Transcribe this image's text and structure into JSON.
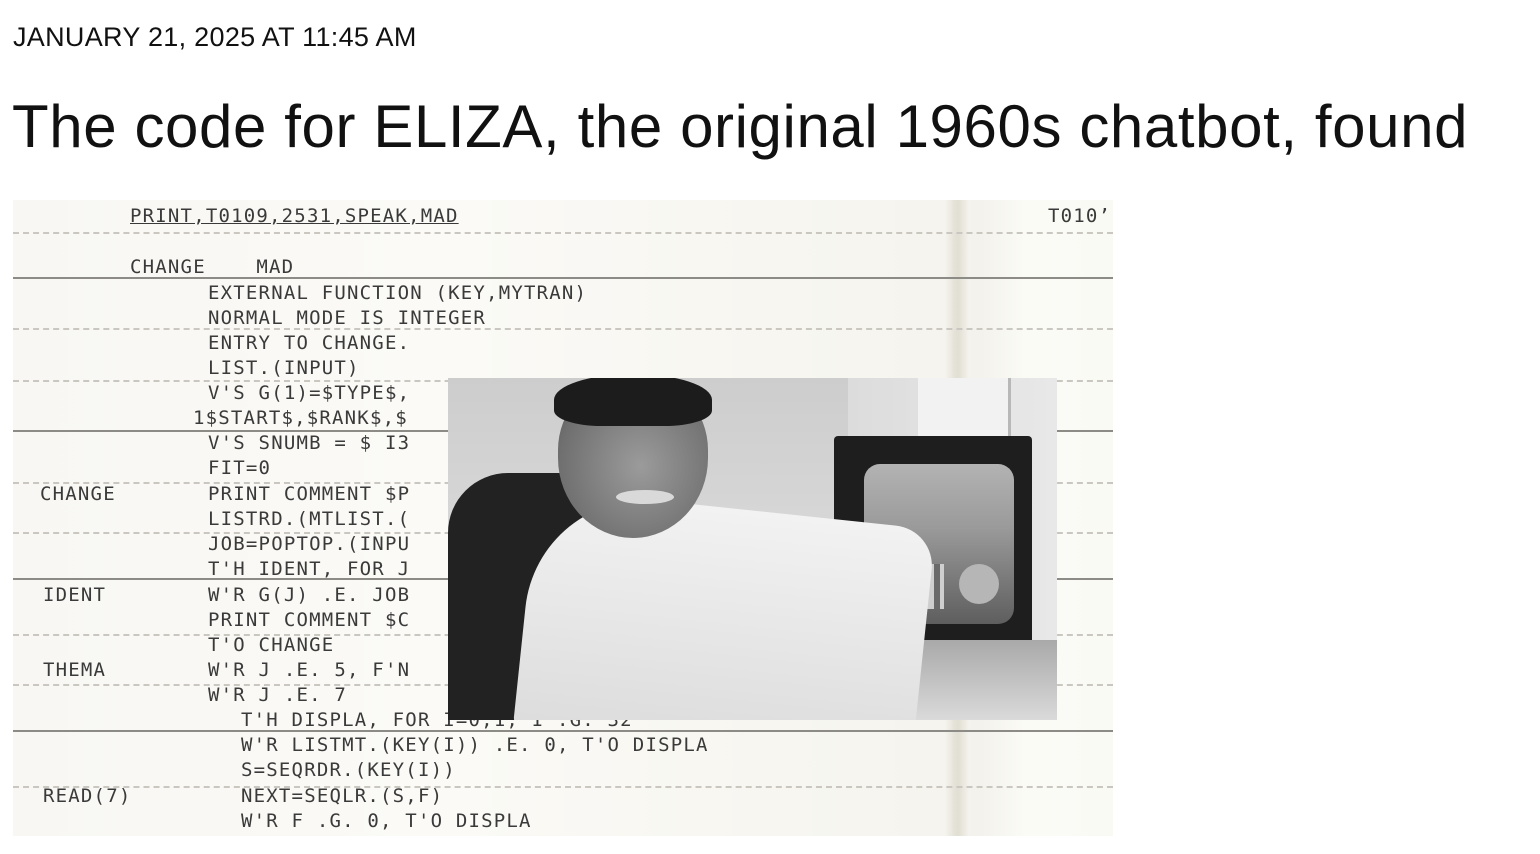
{
  "article": {
    "dateline": "JANUARY 21, 2025 AT 11:45 AM",
    "headline": "The code for ELIZA, the original 1960s chatbot, found"
  },
  "hero_image": {
    "code_lines": {
      "l01": "PRINT,T0109,2531,SPEAK,MAD",
      "l01_right": "T010’",
      "l02": "CHANGE    MAD",
      "l03": "EXTERNAL FUNCTION (KEY,MYTRAN)",
      "l04": "NORMAL MODE IS INTEGER",
      "l05": "ENTRY TO CHANGE.",
      "l06": "LIST.(INPUT)",
      "l07": "V'S G(1)=$TYPE$,",
      "l08": "1$START$,$RANK$,$",
      "l09": "V'S SNUMB = $ I3",
      "l10": "FIT=0",
      "l11": "PRINT COMMENT $P",
      "l12": "LISTRD.(MTLIST.(",
      "l13": "JOB=POPTOP.(INPU",
      "l14": "T'H IDENT, FOR J",
      "l15": "W'R G(J) .E. JOB",
      "l16": "PRINT COMMENT $C",
      "l17": "T'O CHANGE",
      "l18": "W'R J .E. 5, F'N",
      "l19": "W'R J .E. 7",
      "l20": "T'H DISPLA, FOR I=0,1, I .G. 32",
      "l21": "W'R LISTMT.(KEY(I)) .E. 0, T'O DISPLA",
      "l22": "S=SEQRDR.(KEY(I))",
      "l23": "NEXT=SEQLR.(S,F)",
      "l24": "W'R F .G. 0, T'O DISPLA"
    },
    "labels": {
      "change": "CHANGE",
      "ident": "IDENT",
      "thema": "THEMA",
      "read": "READ(7)"
    }
  }
}
